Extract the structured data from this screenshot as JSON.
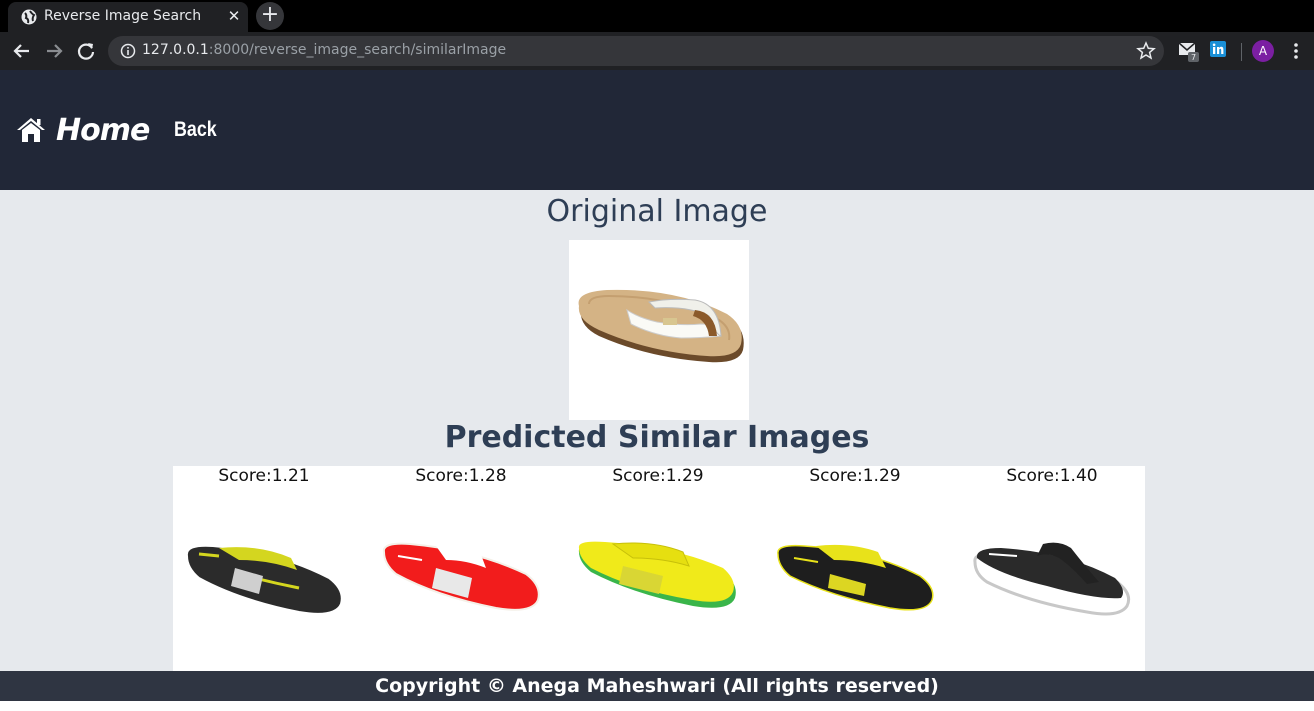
{
  "browser": {
    "tab_title": "Reverse Image Search",
    "tab_close": "✕",
    "new_tab": "+",
    "url_host": "127.0.0.1",
    "url_path": ":8000/reverse_image_search/similarImage",
    "avatar_letter": "A",
    "mail_badge": "7"
  },
  "navbar": {
    "home_label": "Home",
    "back_label": "Back"
  },
  "main": {
    "original_heading": "Original Image",
    "predicted_heading": "Predicted Similar Images",
    "results": [
      {
        "score": "Score:1.21",
        "color": "#2a2a2a",
        "accent": "#d4d61f"
      },
      {
        "score": "Score:1.28",
        "color": "#f21c1c",
        "accent": "#ffffff"
      },
      {
        "score": "Score:1.29",
        "color": "#f0ea1a",
        "accent": "#3ab54a"
      },
      {
        "score": "Score:1.29",
        "color": "#1e1e1e",
        "accent": "#e8e21a"
      },
      {
        "score": "Score:1.40",
        "color": "#222222",
        "accent": "#ffffff"
      }
    ]
  },
  "footer": {
    "copyright": "Copyright © Anega Maheshwari (All rights reserved)"
  },
  "colors": {
    "navbar_bg": "#212737",
    "page_bg": "#e6e9ed",
    "heading": "#2e3e55",
    "footer_bg": "#2f3542"
  }
}
